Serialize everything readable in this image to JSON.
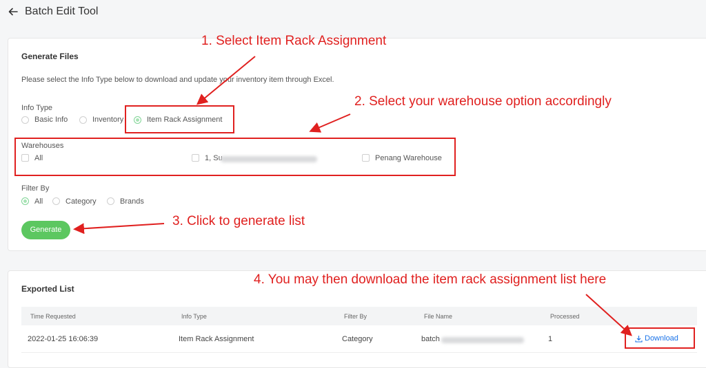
{
  "header": {
    "title": "Batch Edit Tool",
    "back_icon": "arrow-left-icon"
  },
  "generate": {
    "title": "Generate Files",
    "description": "Please select the Info Type below to download and update your inventory item through Excel.",
    "info_type": {
      "label": "Info Type",
      "options": [
        "Basic Info",
        "Inventory",
        "Item Rack Assignment"
      ],
      "selected": "Item Rack Assignment"
    },
    "warehouses": {
      "label": "Warehouses",
      "options": [
        "All",
        "1, Su",
        "Penang Warehouse"
      ]
    },
    "filter_by": {
      "label": "Filter By",
      "options": [
        "All",
        "Category",
        "Brands"
      ],
      "selected": "All"
    },
    "generate_button": "Generate"
  },
  "exported": {
    "title": "Exported List",
    "columns": [
      "Time Requested",
      "Info Type",
      "Filter By",
      "File Name",
      "Processed"
    ],
    "rows": [
      {
        "time": "2022-01-25 16:06:39",
        "info_type": "Item Rack Assignment",
        "filter_by": "Category",
        "file_name": "batch",
        "processed": "1",
        "action": "Download",
        "action_icon": "download-icon"
      }
    ]
  },
  "annotations": {
    "step1": "1. Select Item Rack Assignment",
    "step2": "2. Select your warehouse option accordingly",
    "step3": "3. Click to generate list",
    "step4": "4. You may then download the item rack assignment list here",
    "color": "#e0201f"
  },
  "colors": {
    "accent_green": "#5cc760",
    "link_blue": "#1a73e8",
    "annotation_red": "#e0201f"
  }
}
